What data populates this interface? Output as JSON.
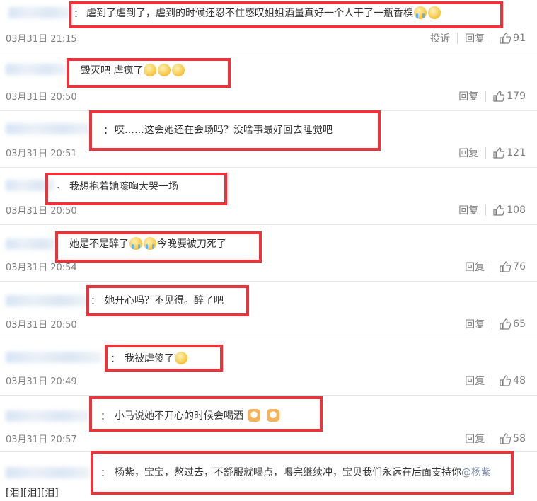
{
  "comments": [
    {
      "text": "虐到了虐到了，虐到的时候还忍不住感叹姐姐酒量真好一个人干了一瓶香槟",
      "emoji": [
        "cry",
        "laugh"
      ],
      "time": "03月31日 21:15",
      "report": "投诉",
      "reply": "回复",
      "likes": "91"
    },
    {
      "text": "毁灭吧 虐疯了",
      "emoji": [
        "smile",
        "smile",
        "smile"
      ],
      "time": "03月31日 20:50",
      "reply": "回复",
      "likes": "179"
    },
    {
      "text": "哎……这会她还在会场吗？没啥事最好回去睡觉吧",
      "emoji": [],
      "time": "03月31日 20:51",
      "reply": "回复",
      "likes": "121"
    },
    {
      "text": "我想抱着她嚎啕大哭一场",
      "emoji": [],
      "time": "03月31日 20:50",
      "reply": "回复",
      "likes": "108"
    },
    {
      "text": "她是不是醉了",
      "text2": "今晚要被刀死了",
      "emoji": [
        "cry",
        "cry"
      ],
      "time": "03月31日 20:54",
      "reply": "回复",
      "likes": "76"
    },
    {
      "text": "她开心吗？不见得。醉了吧",
      "emoji": [],
      "time": "03月31日 20:50",
      "reply": "回复",
      "likes": "65"
    },
    {
      "text": "我被虐傻了",
      "emoji": [
        "smile"
      ],
      "time": "03月31日 20:49",
      "reply": "回复",
      "likes": "48"
    },
    {
      "text": "小马说她不开心的时候会喝酒",
      "emoji": [
        "dog",
        "dog"
      ],
      "time": "03月31日 20:57",
      "reply": "回复",
      "likes": "58"
    },
    {
      "text": "杨紫，宝宝，熬过去，不舒服就喝点，喝完继续冲，宝贝我们永远在后面支持你",
      "mention": "@杨紫",
      "emoji": [],
      "time": "",
      "reply": "",
      "likes": ""
    }
  ],
  "footer": "[泪][泪][泪]",
  "colors": {
    "highlight": "#e8343a",
    "meta": "#808080",
    "name_blur": "#cfe0f3"
  }
}
